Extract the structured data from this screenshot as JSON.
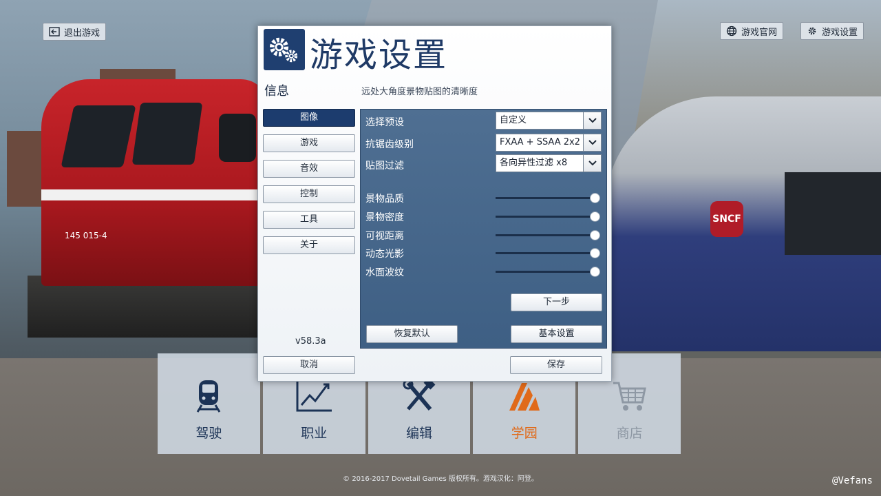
{
  "top_bar": {
    "exit_label": "退出游戏",
    "website_label": "游戏官网",
    "settings_label": "游戏设置"
  },
  "dialog": {
    "title": "游戏设置",
    "info_label": "信息",
    "info_description": "远处大角度景物贴图的清晰度",
    "nav": [
      {
        "label": "图像",
        "active": true
      },
      {
        "label": "游戏",
        "active": false
      },
      {
        "label": "音效",
        "active": false
      },
      {
        "label": "控制",
        "active": false
      },
      {
        "label": "工具",
        "active": false
      },
      {
        "label": "关于",
        "active": false
      }
    ],
    "version": "v58.3a",
    "dropdowns": [
      {
        "label": "选择预设",
        "value": "自定义"
      },
      {
        "label": "抗锯齿级别",
        "value": "FXAA + SSAA 2x2"
      },
      {
        "label": "贴图过滤",
        "value": "各向异性过滤 x8"
      }
    ],
    "sliders": [
      {
        "label": "景物品质",
        "level": 1.0
      },
      {
        "label": "景物密度",
        "level": 1.0
      },
      {
        "label": "可视距离",
        "level": 1.0
      },
      {
        "label": "动态光影",
        "level": 1.0
      },
      {
        "label": "水面波纹",
        "level": 1.0
      }
    ],
    "next_label": "下一步",
    "restore_label": "恢复默认",
    "basic_label": "基本设置",
    "cancel_label": "取消",
    "save_label": "保存"
  },
  "menu": [
    {
      "label": "驾驶",
      "icon": "train-icon"
    },
    {
      "label": "职业",
      "icon": "chart-icon"
    },
    {
      "label": "编辑",
      "icon": "tools-icon"
    },
    {
      "label": "学园",
      "icon": "academy-icon"
    },
    {
      "label": "商店",
      "icon": "cart-icon"
    }
  ],
  "background": {
    "red_loco_number": "145 015-4",
    "tgv_logo": "SNCF"
  },
  "colors": {
    "accent_blue": "#1c3c6e",
    "panel_blue": "#46678b",
    "academy_orange": "#e06a1a"
  },
  "copyright": "© 2016-2017 Dovetail Games 版权所有。游戏汉化：阿登。",
  "watermark": "@Vefans"
}
